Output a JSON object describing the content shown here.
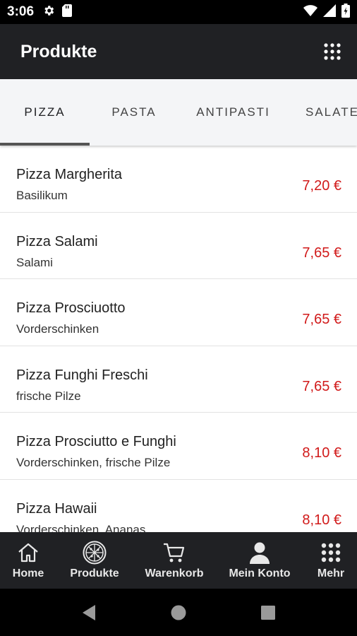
{
  "status_bar": {
    "time": "3:06"
  },
  "app_bar": {
    "title": "Produkte"
  },
  "tabs": [
    {
      "label": "PIZZA",
      "active": true
    },
    {
      "label": "PASTA",
      "active": false
    },
    {
      "label": "ANTIPASTI",
      "active": false
    },
    {
      "label": "SALATE",
      "active": false
    }
  ],
  "products": [
    {
      "name": "Pizza Margherita",
      "description": "Basilikum",
      "price": "7,20 €"
    },
    {
      "name": "Pizza Salami",
      "description": "Salami",
      "price": "7,65 €"
    },
    {
      "name": "Pizza Prosciuotto",
      "description": "Vorderschinken",
      "price": "7,65 €"
    },
    {
      "name": "Pizza Funghi Freschi",
      "description": "frische Pilze",
      "price": "7,65 €"
    },
    {
      "name": "Pizza Prosciutto e Funghi",
      "description": "Vorderschinken, frische Pilze",
      "price": "8,10 €"
    },
    {
      "name": "Pizza Hawaii",
      "description": "Vorderschinken, Ananas",
      "price": "8,10 €"
    }
  ],
  "bottom_nav": [
    {
      "label": "Home",
      "icon": "home-icon"
    },
    {
      "label": "Produkte",
      "icon": "pizza-icon"
    },
    {
      "label": "Warenkorb",
      "icon": "cart-icon"
    },
    {
      "label": "Mein Konto",
      "icon": "person-icon"
    },
    {
      "label": "Mehr",
      "icon": "grid-icon"
    }
  ],
  "colors": {
    "app_bar": "#202124",
    "price": "#d11a1a",
    "tab_background": "#f4f5f7"
  }
}
